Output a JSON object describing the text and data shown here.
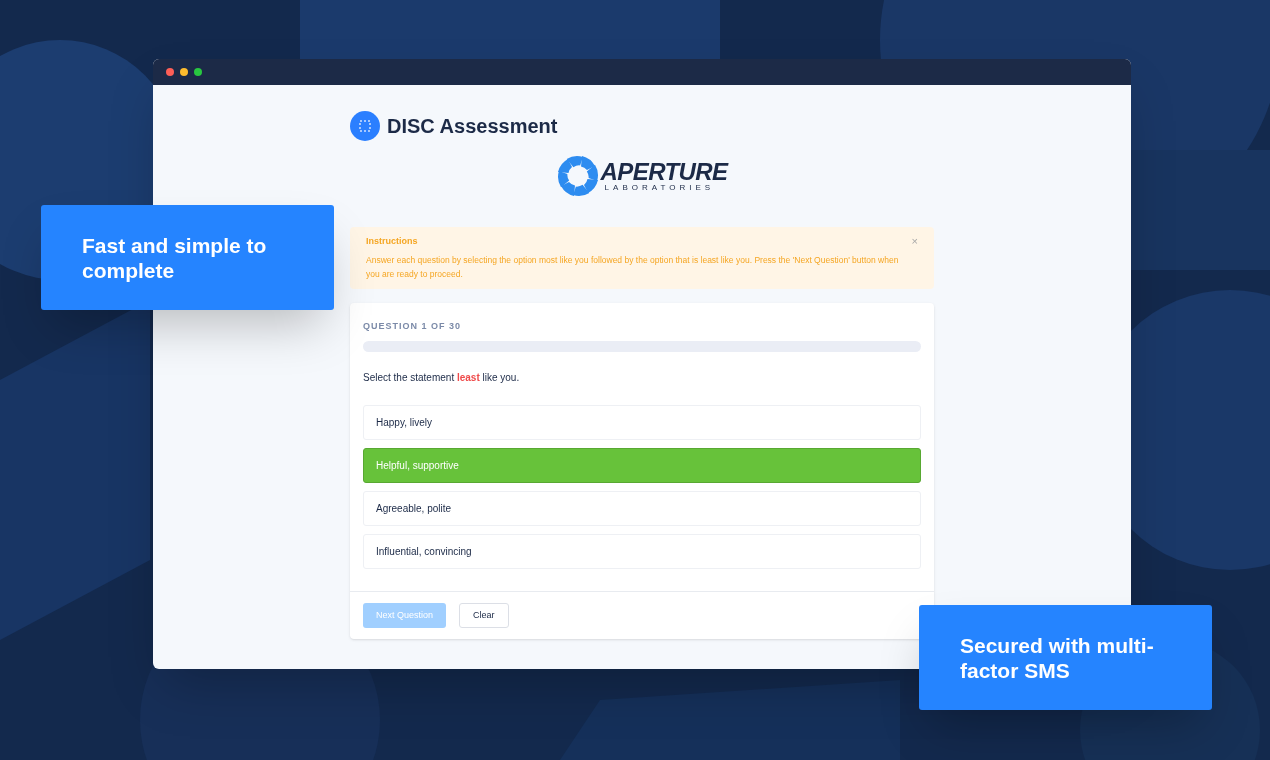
{
  "callouts": [
    {
      "text": "Fast and simple to complete"
    },
    {
      "text": "Secured with multi-factor SMS"
    }
  ],
  "header": {
    "title": "DISC Assessment"
  },
  "logo": {
    "name": "APERTURE",
    "subtitle": "LABORATORIES"
  },
  "instructions": {
    "title": "Instructions",
    "text": "Answer each question by selecting the option most like you followed by the option that is least like you. Press the 'Next Question' button when you are ready to proceed.",
    "close": "×"
  },
  "question": {
    "counter": "QUESTION 1 OF 30",
    "prompt": "Select the statement **least** like you.",
    "options": [
      {
        "label": "Happy, lively",
        "selected": false
      },
      {
        "label": "Helpful, supportive",
        "selected": true
      },
      {
        "label": "Agreeable, polite",
        "selected": false
      },
      {
        "label": "Influential, convincing",
        "selected": false
      }
    ]
  },
  "buttons": [
    {
      "label": "Next Question",
      "kind": "primary",
      "disabled": true
    },
    {
      "label": "Clear",
      "kind": "secondary",
      "disabled": false
    }
  ]
}
